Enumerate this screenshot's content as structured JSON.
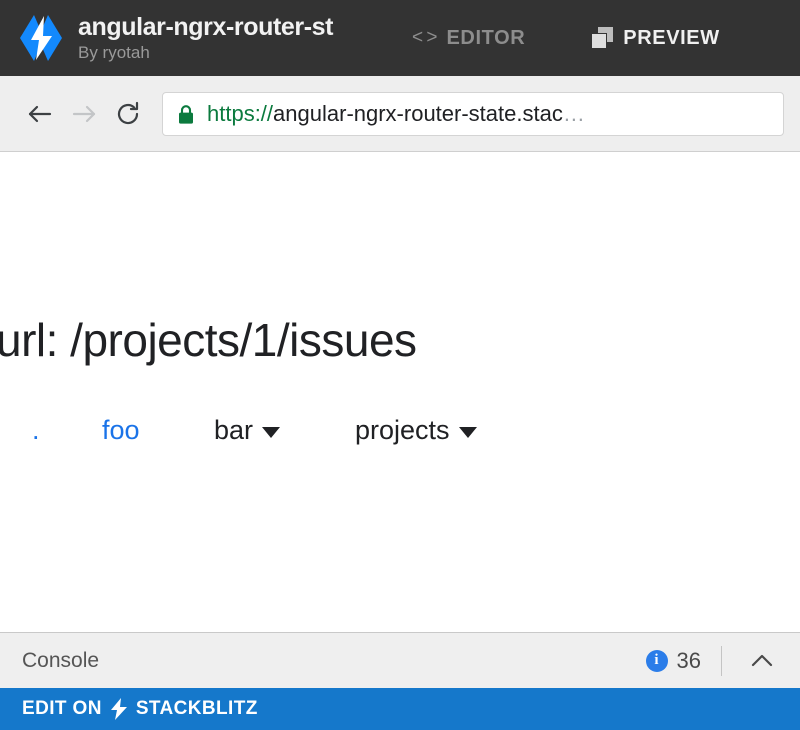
{
  "header": {
    "logo_icon": "stackblitz-bolt-logo",
    "project_title": "angular-ngrx-router-st",
    "author": "By ryotah",
    "editor_tab": {
      "label": "EDITOR",
      "icon": "code-brackets-icon",
      "active": false
    },
    "preview_tab": {
      "label": "PREVIEW",
      "icon": "window-panels-icon",
      "active": true
    }
  },
  "browser": {
    "back_icon": "arrow-left-icon",
    "forward_icon": "arrow-right-icon",
    "reload_icon": "reload-icon",
    "lock_icon": "padlock-icon",
    "url_scheme": "https://",
    "url_host": "angular-ngrx-router-state.stac",
    "url_ellipsis": "…",
    "url_full_display": "https://angular-ngrx-router-state.stac…"
  },
  "preview": {
    "heading": "url: /projects/1/issues",
    "nav": [
      {
        "label": ".",
        "type": "link",
        "has_caret": false
      },
      {
        "label": "foo",
        "type": "link",
        "has_caret": false
      },
      {
        "label": "bar",
        "type": "dropdown",
        "has_caret": true
      },
      {
        "label": "projects",
        "type": "dropdown",
        "has_caret": true
      }
    ]
  },
  "console": {
    "label": "Console",
    "info_icon": "info-circle-icon",
    "info_glyph": "i",
    "count": "36",
    "expand_icon": "chevron-up-icon"
  },
  "footer": {
    "prefix": "EDIT ON",
    "bolt_icon": "lightning-bolt-icon",
    "brand": "STACKBLITZ"
  },
  "colors": {
    "header_bg": "#333333",
    "brand_blue": "#1578cb",
    "logo_blue": "#1389fd",
    "link_blue": "#1a73e8",
    "https_green": "#0b7a3e",
    "info_blue": "#2b7de9",
    "toolbar_bg": "#eeeeee",
    "console_bg": "#efefef"
  }
}
